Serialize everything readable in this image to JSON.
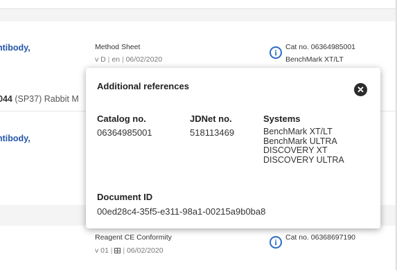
{
  "rows": [
    {
      "title_fragment": "ntibody,",
      "doc_type": "Method Sheet",
      "doc_version": "v D",
      "doc_lang": "en",
      "doc_date": "06/02/2020",
      "cat_label": "Cat no. 06364985001",
      "cat_system": "BenchMark XT/LT"
    },
    {
      "desc_bold": "044",
      "desc_rest": " (SP37) Rabbit M"
    },
    {
      "title_fragment": "ntibody,"
    },
    {
      "doc_type": "Reagent CE Conformity",
      "doc_version": "v 01",
      "doc_date": "06/02/2020",
      "cat_label": "Cat no. 06368697190"
    }
  ],
  "popup": {
    "title": "Additional references",
    "columns": {
      "catalog_header": "Catalog no.",
      "catalog_value": "06364985001",
      "jdnet_header": "JDNet no.",
      "jdnet_value": "518113469",
      "systems_header": "Systems",
      "systems": [
        "BenchMark XT/LT",
        "BenchMark ULTRA",
        "DISCOVERY XT",
        "DISCOVERY ULTRA"
      ]
    },
    "document_id_header": "Document ID",
    "document_id_value": "00ed28c4-35f5-e311-98a1-00215a9b0ba8"
  },
  "icons": {
    "info": "info-circle-icon",
    "close": "close-circle-icon",
    "grid": "grid-icon"
  },
  "colors": {
    "link": "#2356a8",
    "info_icon": "#2b6cc4",
    "close_button": "#2b2b2b"
  }
}
